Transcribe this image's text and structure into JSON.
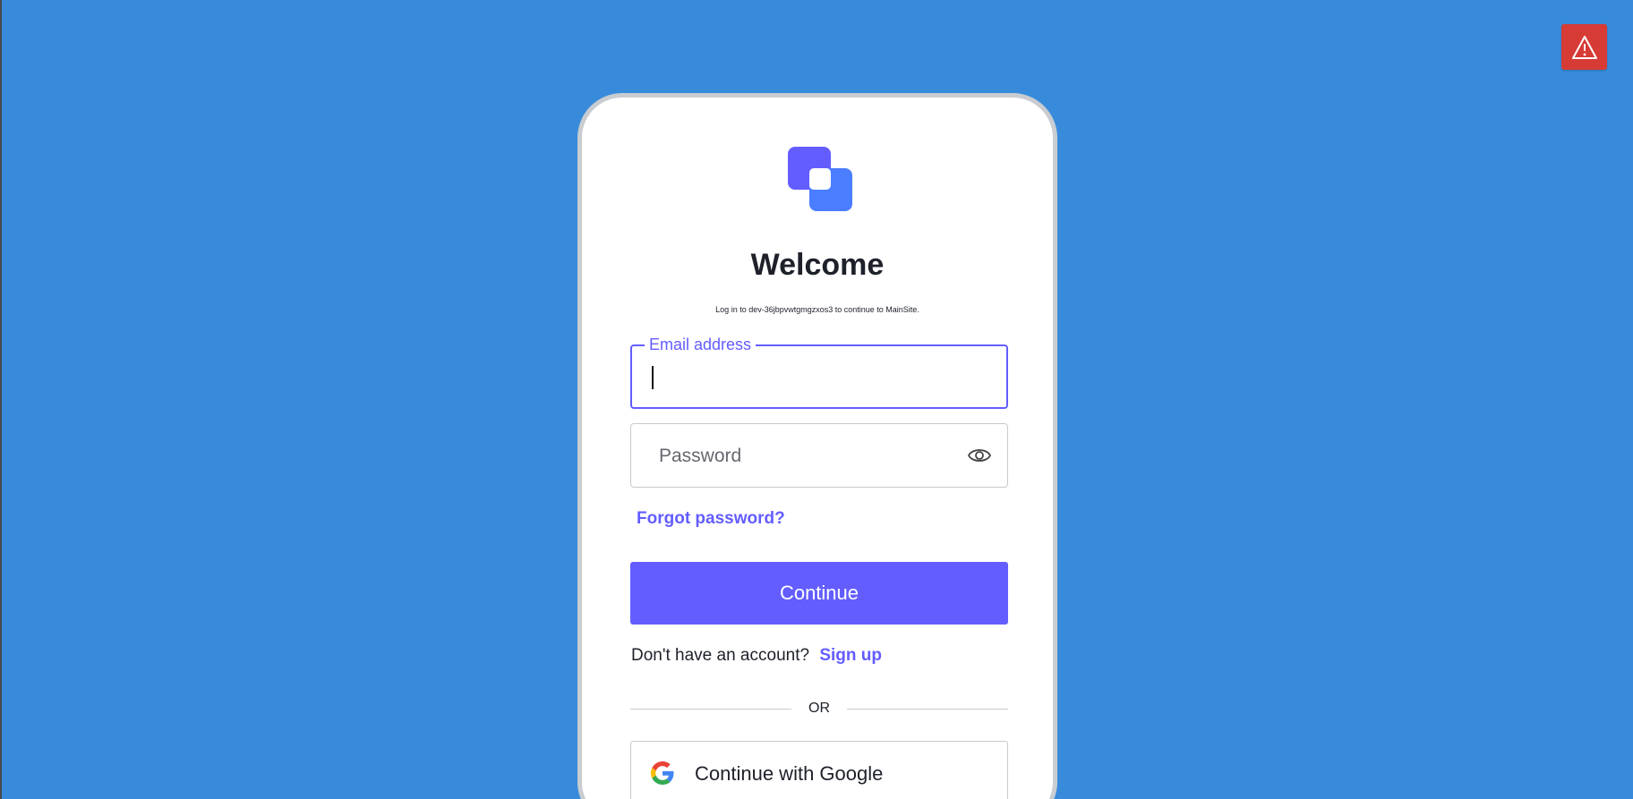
{
  "colors": {
    "background": "#388bdb",
    "accent": "#635dff",
    "alert": "#d63b35",
    "text": "#1e212a"
  },
  "alert": {
    "icon": "warning-icon"
  },
  "login": {
    "logo_icon": "brand-logo-icon",
    "title": "Welcome",
    "subtitle": "Log in to dev-36jbpvwtgmgzxos3 to continue to MainSite.",
    "email": {
      "label": "Email address",
      "value": ""
    },
    "password": {
      "placeholder": "Password",
      "toggle_icon": "eye-icon"
    },
    "forgot_password": "Forgot password?",
    "continue_label": "Continue",
    "signup_prompt": "Don't have an account?",
    "signup_link": "Sign up",
    "divider": "OR",
    "google_label": "Continue with Google",
    "google_icon": "google-icon"
  }
}
